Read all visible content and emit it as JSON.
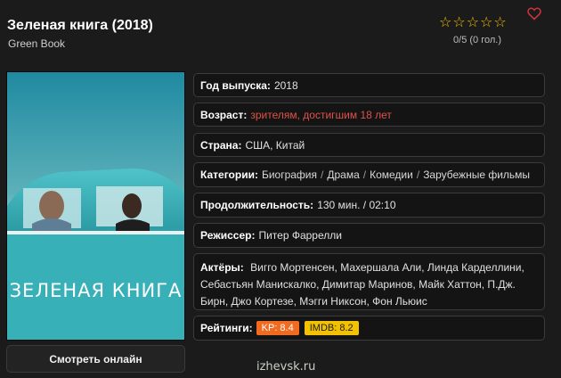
{
  "movie": {
    "title": "Зеленая книга (2018)",
    "original_title": "Green Book",
    "user_rating": "0/5 (0 гол.)",
    "stars": [
      "☆",
      "☆",
      "☆",
      "☆",
      "☆"
    ],
    "poster_title": "ЗЕЛЕНАЯ КНИГА"
  },
  "info": {
    "year_label": "Год выпуска:",
    "year_value": "2018",
    "age_label": "Возраст:",
    "age_value": "зрителям, достигшим 18 лет",
    "country_label": "Страна:",
    "country_value": "США, Китай",
    "categories_label": "Категории:",
    "categories": [
      "Биография",
      "Драма",
      "Комедии",
      "Зарубежные фильмы"
    ],
    "duration_label": "Продолжительность:",
    "duration_value": "130 мин. / 02:10",
    "director_label": "Режиссер:",
    "director_value": "Питер Фаррелли",
    "actors_label": "Актёры:",
    "actors_value": "Вигго Мортенсен, Махершала Али, Линда Карделлини, Себастьян Манискалко, Димитар Маринов, Майк Хаттон, П.Дж. Бирн, Джо Кортезе, Мэгги Никсон, Фон Льюис",
    "ratings_label": "Рейтинги:",
    "kp": "KP: 8.4",
    "imdb": "IMDB: 8.2"
  },
  "actions": {
    "watch_online": "Смотреть онлайн"
  },
  "watermark": "izhevsk.ru",
  "colors": {
    "background": "#1b1b1b",
    "star": "#f2c200",
    "heart": "#c9343c",
    "age_red": "#e0524a",
    "kp_badge": "#f06b1f",
    "imdb_badge": "#f2c200"
  }
}
